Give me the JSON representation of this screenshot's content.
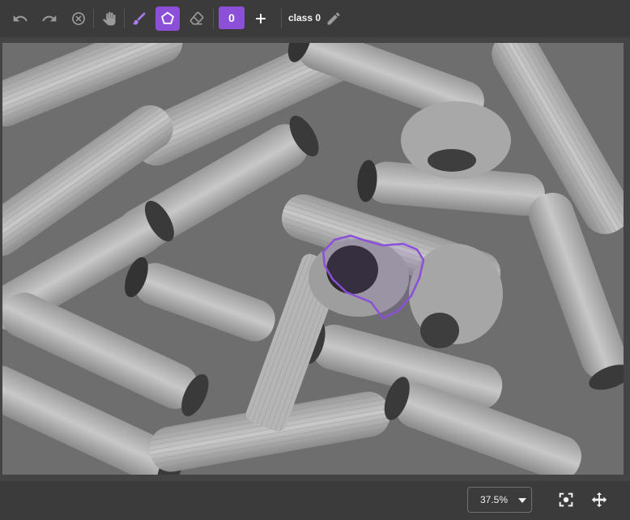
{
  "toolbar": {
    "class_chip_value": "0",
    "class_label": "class 0",
    "accent_color": "#8b4fd8"
  },
  "icons": {
    "undo": "undo-icon",
    "redo": "redo-icon",
    "cancel": "cancel-icon",
    "pan": "hand-icon",
    "brush": "brush-icon",
    "polygon": "polygon-icon",
    "eraser": "eraser-icon",
    "add": "plus-icon",
    "edit": "pencil-icon",
    "fit": "focus-icon",
    "move": "move-icon"
  },
  "canvas": {
    "annotation_color": "#8b4fd8"
  },
  "bottom": {
    "zoom_value": "37.5%"
  }
}
